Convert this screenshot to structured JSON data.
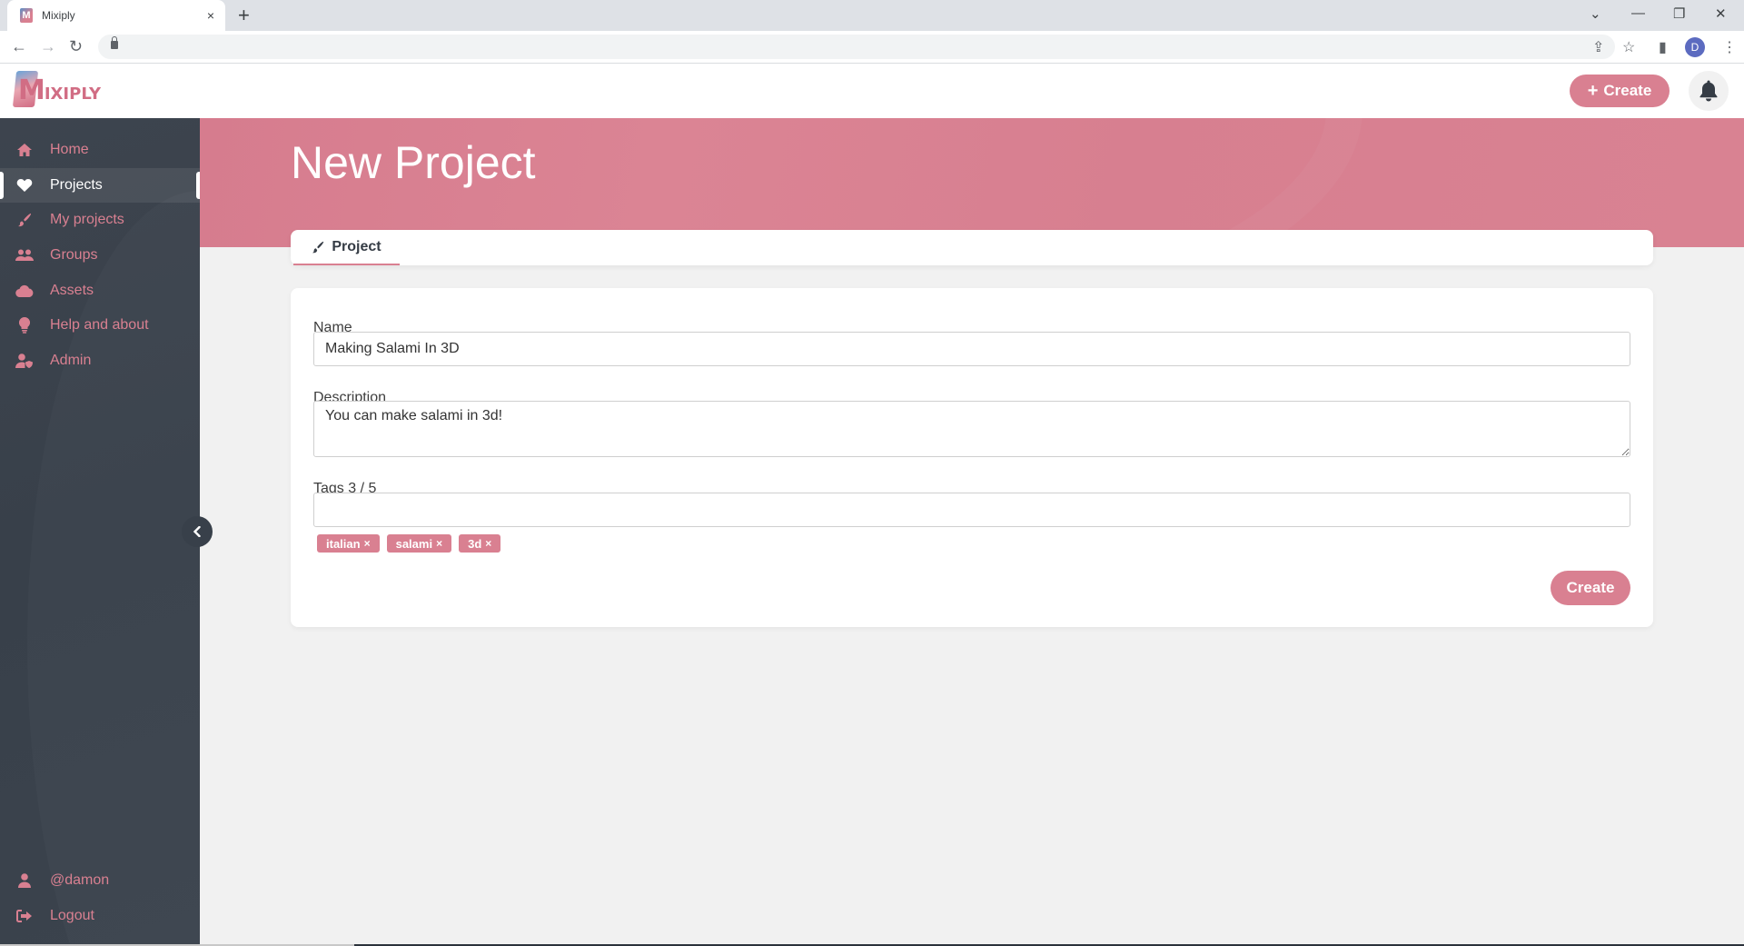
{
  "browser": {
    "tab_title": "Mixiply",
    "tab_close": "×",
    "new_tab": "+",
    "profile_initial": "D",
    "window_controls": {
      "dropdown": "⌄",
      "minimize": "—",
      "restore": "❐",
      "close": "✕"
    },
    "nav": {
      "back": "←",
      "forward": "→",
      "reload": "↻"
    }
  },
  "header": {
    "logo_text": "MIXIPLY",
    "create_label": "Create",
    "create_icon": "plus-icon",
    "notifications_icon": "bell-icon"
  },
  "sidebar": {
    "items": [
      {
        "label": "Home",
        "icon": "home-icon",
        "active": false
      },
      {
        "label": "Projects",
        "icon": "heart-icon",
        "active": true
      },
      {
        "label": "My projects",
        "icon": "paintbrush-icon",
        "active": false
      },
      {
        "label": "Groups",
        "icon": "users-icon",
        "active": false
      },
      {
        "label": "Assets",
        "icon": "cloud-icon",
        "active": false
      },
      {
        "label": "Help and about",
        "icon": "lightbulb-icon",
        "active": false
      },
      {
        "label": "Admin",
        "icon": "user-shield-icon",
        "active": false
      }
    ],
    "bottom": [
      {
        "label": "@damon",
        "icon": "user-icon"
      },
      {
        "label": "Logout",
        "icon": "logout-icon"
      }
    ],
    "collapse_icon": "chevron-left-icon"
  },
  "page": {
    "title": "New Project",
    "tabs": [
      {
        "label": "Project",
        "icon": "paintbrush-icon",
        "active": true
      }
    ]
  },
  "form": {
    "name_label": "Name",
    "name_value": "Making Salami In 3D",
    "description_label": "Description",
    "description_value": "You can make salami in 3d!",
    "tags_label": "Tags 3 / 5",
    "tags_input_value": "",
    "tags": [
      "italian",
      "salami",
      "3d"
    ],
    "tag_remove": "×",
    "submit_label": "Create"
  },
  "colors": {
    "accent": "#d98091",
    "sidebar_bg": "#3b424c",
    "page_bg": "#f1f1f1",
    "title_text": "#ffffff"
  }
}
